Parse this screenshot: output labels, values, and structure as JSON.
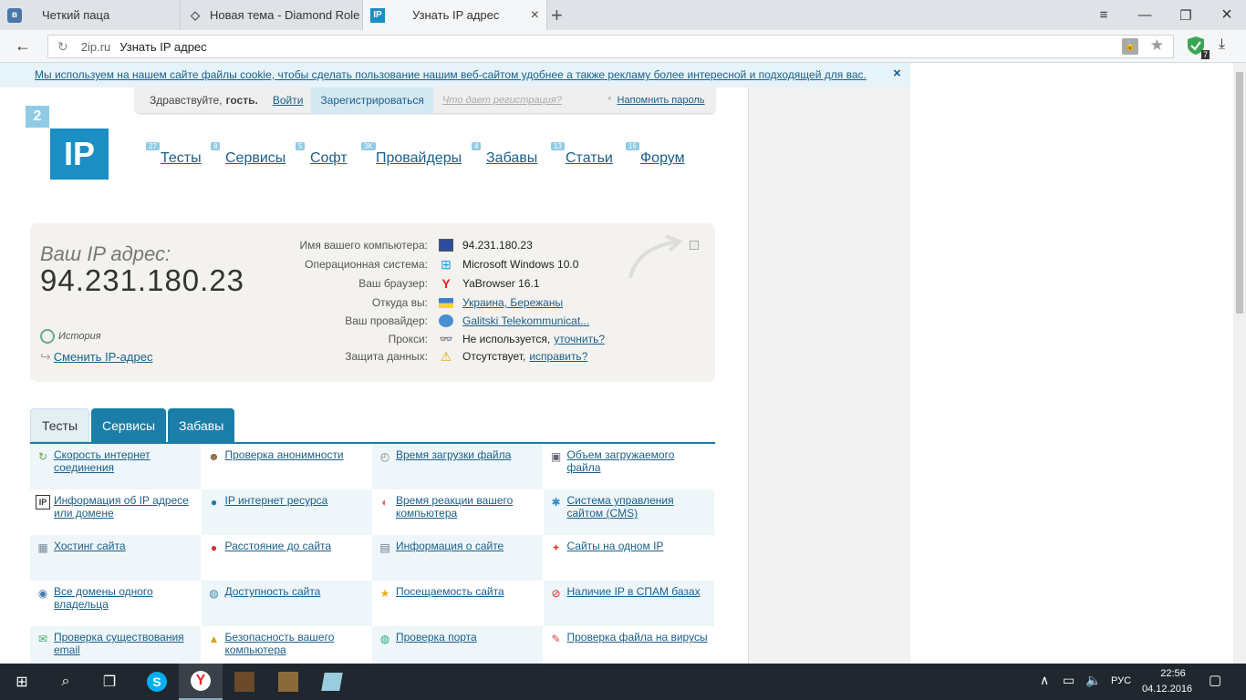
{
  "tabs": [
    {
      "title": "Четкий паца",
      "icon": "vk-icon"
    },
    {
      "title": "Новая тема - Diamond Role",
      "icon": "diamond-icon"
    },
    {
      "title": "Узнать IP адрес",
      "icon": "ip-icon",
      "fav": "IP"
    }
  ],
  "address": {
    "domain": "2ip.ru",
    "page_title": "Узнать IP адрес"
  },
  "extension_badge": "7",
  "cookie_text": "Мы используем на нашем сайте файлы cookie, чтобы сделать пользование нашим веб-сайтом удобнее а также рекламу более интересной и подходящей для вас.",
  "cookie_close": "×",
  "login": {
    "greeting": "Здравствуйте,",
    "guest": "гость.",
    "login_link": "Войти",
    "register": "Зарегистрироваться",
    "why_register": "Что дает регистрация?",
    "star": "*",
    "remind": "Напомнить пароль"
  },
  "logo": {
    "digit": "2",
    "text": "IP"
  },
  "nav": [
    {
      "label": "Тесты",
      "count": "27"
    },
    {
      "label": "Сервисы",
      "count": "8"
    },
    {
      "label": "Софт",
      "count": "5"
    },
    {
      "label": "Провайдеры",
      "count": "3K"
    },
    {
      "label": "Забавы",
      "count": "4"
    },
    {
      "label": "Статьи",
      "count": "13"
    },
    {
      "label": "Форум",
      "count": "16"
    }
  ],
  "ip_panel": {
    "heading": "Ваш IP адрес:",
    "ip": "94.231.180.23",
    "history": "История",
    "change_ip": "Сменить IP-адрес",
    "rows": [
      {
        "label": "Имя вашего компьютера:",
        "value": "94.231.180.23",
        "link": "",
        "extra": ""
      },
      {
        "label": "Операционная система:",
        "value": "Microsoft Windows 10.0",
        "link": "",
        "extra": ""
      },
      {
        "label": "Ваш браузер:",
        "value": "YaBrowser 16.1",
        "link": "",
        "extra": ""
      },
      {
        "label": "Откуда вы:",
        "value": "",
        "link": "Украина, Бережаны",
        "extra": ""
      },
      {
        "label": "Ваш провайдер:",
        "value": "",
        "link": "Galitski Telekommunicat...",
        "extra": ""
      },
      {
        "label": "Прокси:",
        "value": "Не используется,",
        "link": "",
        "extra": "уточнить?"
      },
      {
        "label": "Защита данных:",
        "value": "Отсутствует,",
        "link": "",
        "extra": "исправить?"
      }
    ]
  },
  "section_tabs": [
    "Тесты",
    "Сервисы",
    "Забавы"
  ],
  "tests": [
    "Скорость интернет соединения",
    "Проверка анонимности",
    "Время загрузки файла",
    "Объем загружаемого файла",
    "Информация об IP адресе или домене",
    "IP интернет ресурса",
    "Время реакции вашего компьютера",
    "Система управления сайтом (CMS)",
    "Хостинг сайта",
    "Расстояние до сайта",
    "Информация о сайте",
    "Сайты на одном IP",
    "Все домены одного владельца",
    "Доступность сайта",
    "Посещаемость сайта",
    "Наличие IP в СПАМ базах",
    "Проверка существования email",
    "Безопасность вашего компьютера",
    "Проверка порта",
    "Проверка файла на вирусы"
  ],
  "taskbar": {
    "lang": "РУС",
    "time": "22:56",
    "date": "04.12.2016"
  },
  "colors": {
    "accent": "#1a7ea8",
    "link": "#1a5f8c",
    "logo": "#1b8fc3"
  }
}
